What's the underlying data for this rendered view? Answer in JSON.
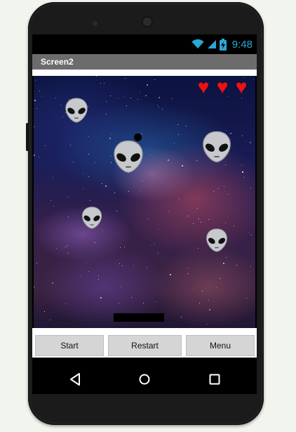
{
  "status_bar": {
    "time": "9:48",
    "icons": [
      "wifi-icon",
      "signal-icon",
      "battery-icon"
    ]
  },
  "screen": {
    "title": "Screen2"
  },
  "game": {
    "lives": 3,
    "heart_icon": "heart-icon",
    "alien_icon": "alien-icon",
    "heart_color": "#ee1111"
  },
  "buttons": {
    "start": "Start",
    "restart": "Restart",
    "menu": "Menu"
  },
  "nav": {
    "icons": [
      "back-icon",
      "home-icon",
      "recents-icon"
    ]
  }
}
